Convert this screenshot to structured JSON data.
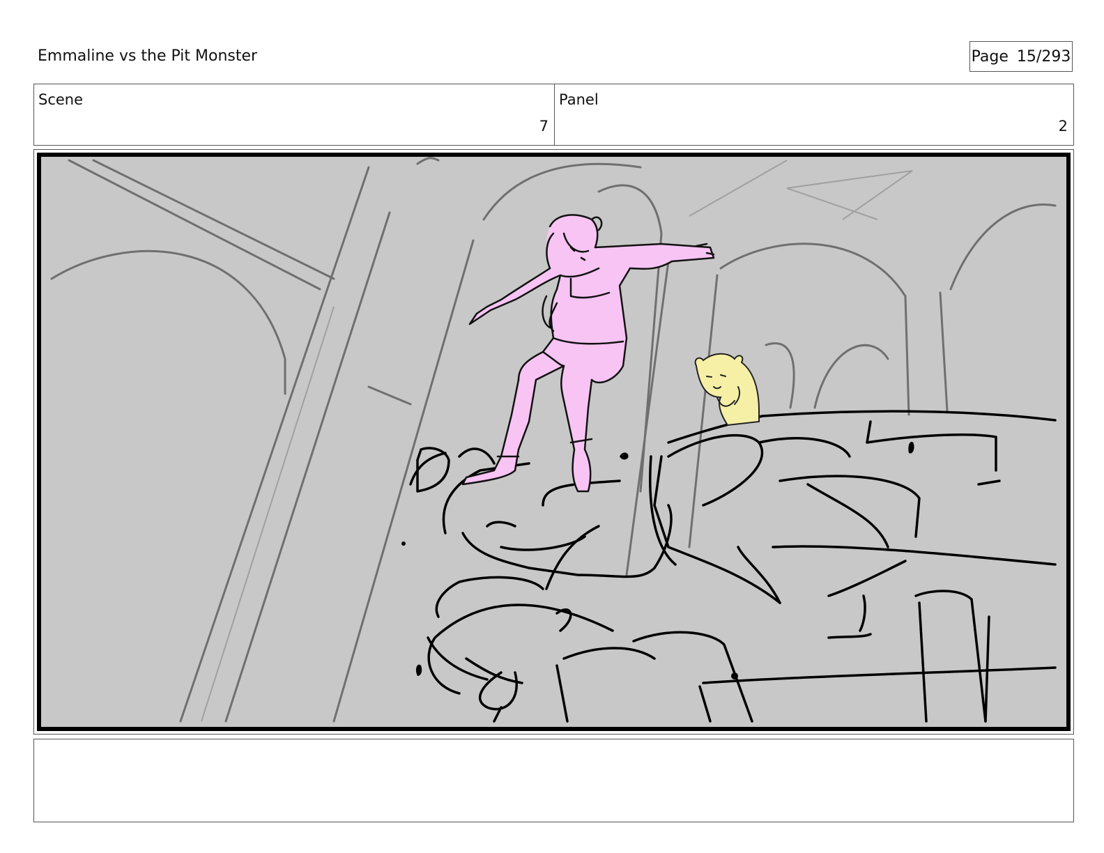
{
  "document": {
    "title": "Emmaline vs the Pit Monster",
    "page_label": "Page",
    "page_number": "15/293"
  },
  "header": {
    "scene_label": "Scene",
    "scene_value": "7",
    "panel_label": "Panel",
    "panel_value": "2"
  },
  "frame": {
    "background_color": "#c8c8c8",
    "girl_color": "#f7c4f4",
    "creature_color": "#f6f0a6",
    "notes": ""
  }
}
